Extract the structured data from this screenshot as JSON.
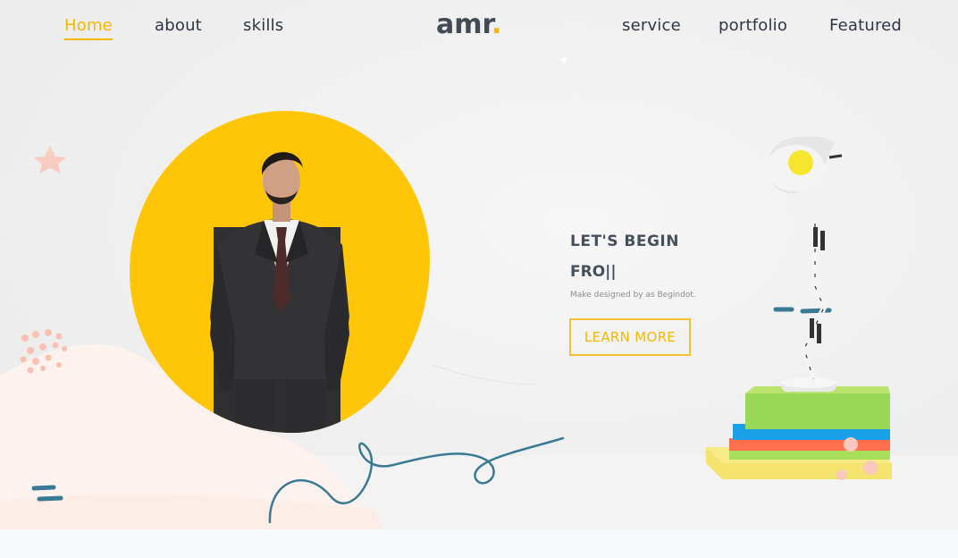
{
  "nav": {
    "left_items": [
      "Home",
      "about",
      "skills"
    ],
    "right_items": [
      "service",
      "portfolio",
      "Featured"
    ],
    "active": "Home"
  },
  "logo": {
    "text": "amr",
    "dot": "."
  },
  "hero": {
    "title": "LET'S BEGIN",
    "typed": "FRO||",
    "subtitle": "Make designed by as Begindot.",
    "cta": "LEARN MORE"
  },
  "colors": {
    "accent": "#f5b800",
    "yellow_blob": "#fec607",
    "text_dark": "#45505c",
    "wavy_line": "#3a7a95"
  },
  "icons": [
    "desk-lamp",
    "book-stack",
    "portrait-photo"
  ]
}
